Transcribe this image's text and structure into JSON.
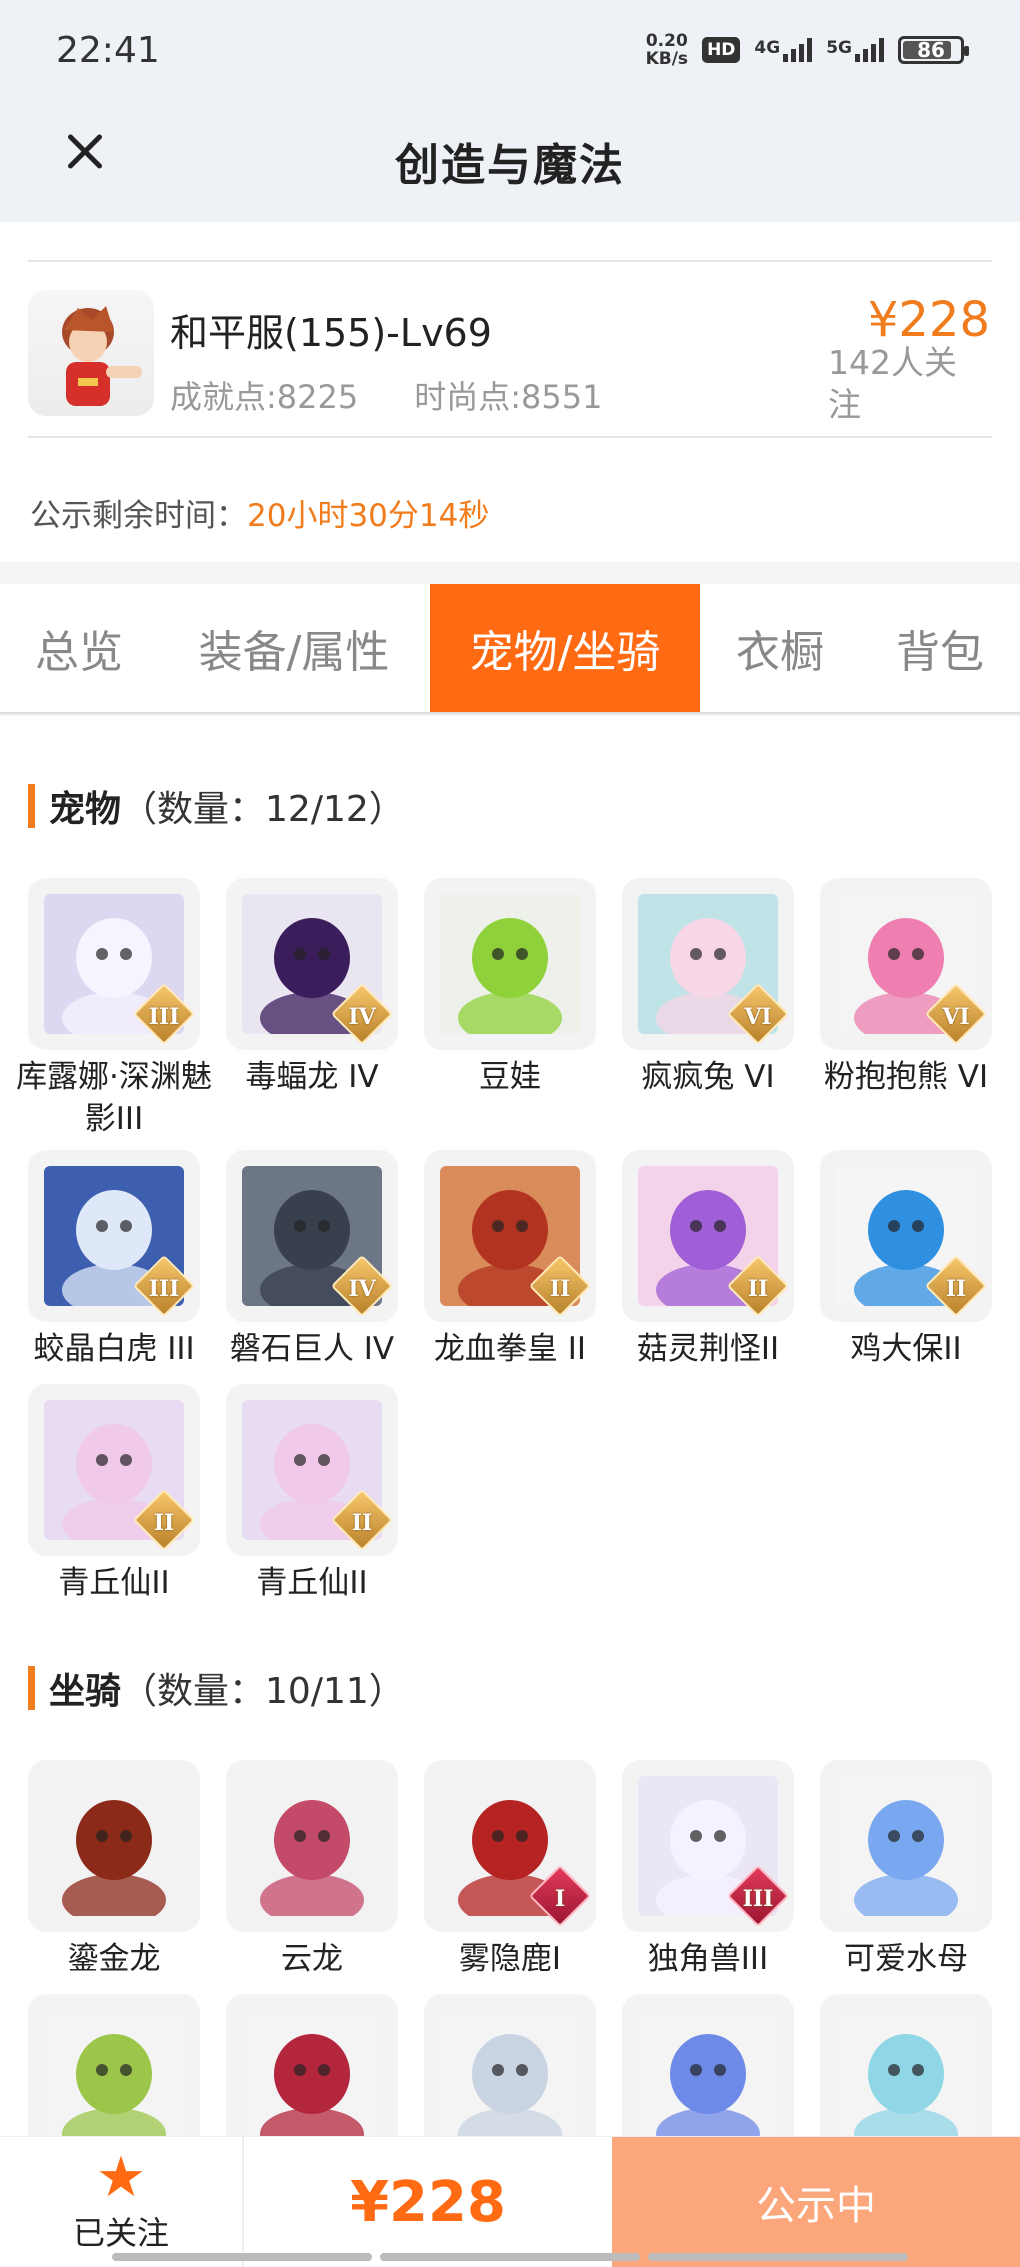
{
  "status_bar": {
    "time": "22:41",
    "net_speed_value": "0.20",
    "net_speed_unit": "KB/s",
    "hd_label": "HD",
    "sig1_label": "4G",
    "sig2_label": "5G",
    "battery": "86",
    "battery_level": 0.86
  },
  "header": {
    "title": "创造与魔法"
  },
  "character": {
    "name": "和平服(155)-Lv69",
    "achievement": "成就点:8225",
    "fashion": "时尚点:8551",
    "price": "¥228",
    "followers": "142人关注"
  },
  "countdown": {
    "label": "公示剩余时间：",
    "value": "20小时30分14秒"
  },
  "tabs": [
    {
      "label": "总览"
    },
    {
      "label": "装备/属性"
    },
    {
      "label": "宠物/坐骑",
      "active": true
    },
    {
      "label": "衣橱"
    },
    {
      "label": "背包"
    }
  ],
  "pets": {
    "title": "宠物",
    "count": "（数量：12/12）",
    "items": [
      {
        "label": "库露娜·深渊魅影III",
        "badge": "III",
        "bg": "#dcd8f2",
        "fg": "#f7f3ff",
        "icon": "ghost-girl-icon"
      },
      {
        "label": "毒蝠龙 IV",
        "badge": "IV",
        "bg": "#e9e6f2",
        "fg": "#3b1d5c",
        "icon": "bat-dragon-icon"
      },
      {
        "label": "豆娃",
        "badge": "",
        "bg": "#eef0ea",
        "fg": "#8fd13a",
        "icon": "green-frog-icon"
      },
      {
        "label": "疯疯兔 VI",
        "badge": "VI",
        "bg": "#bfe3e6",
        "fg": "#f7d6e6",
        "icon": "rabbit-icon"
      },
      {
        "label": "粉抱抱熊 VI",
        "badge": "VI",
        "bg": "#f4f4f4",
        "fg": "#ee7fb0",
        "icon": "pink-bear-icon"
      },
      {
        "label": "蛟晶白虎 III",
        "badge": "III",
        "bg": "#3e5fb0",
        "fg": "#dfe8f8",
        "icon": "white-tiger-icon"
      },
      {
        "label": "磐石巨人 IV",
        "badge": "IV",
        "bg": "#6c7686",
        "fg": "#38404d",
        "icon": "stone-giant-icon"
      },
      {
        "label": "龙血拳皇 II",
        "badge": "II",
        "bg": "#d98b5a",
        "fg": "#b23320",
        "icon": "dragon-fighter-icon"
      },
      {
        "label": "菇灵荆怪II",
        "badge": "II",
        "bg": "#f3d3e9",
        "fg": "#a05fd6",
        "icon": "mushroom-elf-icon"
      },
      {
        "label": "鸡大保II",
        "badge": "II",
        "bg": "#f5f5f5",
        "fg": "#2f8fe0",
        "icon": "blue-bird-icon"
      },
      {
        "label": "青丘仙II",
        "badge": "II",
        "bg": "#e8dcf3",
        "fg": "#f1c9ea",
        "icon": "fox-fairy-icon"
      },
      {
        "label": "青丘仙II",
        "badge": "II",
        "bg": "#e8dcf3",
        "fg": "#f1c9ea",
        "icon": "fox-fairy-icon"
      }
    ]
  },
  "mounts": {
    "title": "坐骑",
    "count": "（数量：10/11）",
    "items": [
      {
        "label": "鎏金龙",
        "badge": "",
        "bg": "#f2f2f2",
        "fg": "#8c2a1a",
        "icon": "gold-dragon-icon"
      },
      {
        "label": "云龙",
        "badge": "",
        "bg": "#f2f2f2",
        "fg": "#c44a6a",
        "icon": "cloud-dragon-icon"
      },
      {
        "label": "雾隐鹿I",
        "badge": "I",
        "bg": "#f2f2f2",
        "fg": "#b52323",
        "icon": "red-deer-icon"
      },
      {
        "label": "独角兽III",
        "badge": "III",
        "bg": "#eae6f4",
        "fg": "#f5f1ff",
        "icon": "unicorn-icon"
      },
      {
        "label": "可爱水母",
        "badge": "",
        "bg": "#f4f4f4",
        "fg": "#7aa8f0",
        "icon": "jellyfish-icon"
      },
      {
        "label": "",
        "badge": "",
        "bg": "#f4f4f4",
        "fg": "#9cc64a",
        "icon": "green-creature-icon"
      },
      {
        "label": "",
        "badge": "",
        "bg": "#f4f4f4",
        "fg": "#b4263c",
        "icon": "red-bird-icon"
      },
      {
        "label": "",
        "badge": "",
        "bg": "#f4f4f4",
        "fg": "#c9d4e2",
        "icon": "white-fox-icon"
      },
      {
        "label": "",
        "badge": "",
        "bg": "#f4f4f4",
        "fg": "#6d8ae8",
        "icon": "blue-dragon-icon"
      },
      {
        "label": "",
        "badge": "",
        "bg": "#f4f4f4",
        "fg": "#8fd6e6",
        "icon": "skateboard-icon"
      }
    ]
  },
  "bottom_bar": {
    "follow_label": "已关注",
    "price": "¥228",
    "action_label": "公示中"
  },
  "colors": {
    "accent": "#ff6a13",
    "price": "#f07c1d",
    "action_bg": "#fca67c"
  }
}
